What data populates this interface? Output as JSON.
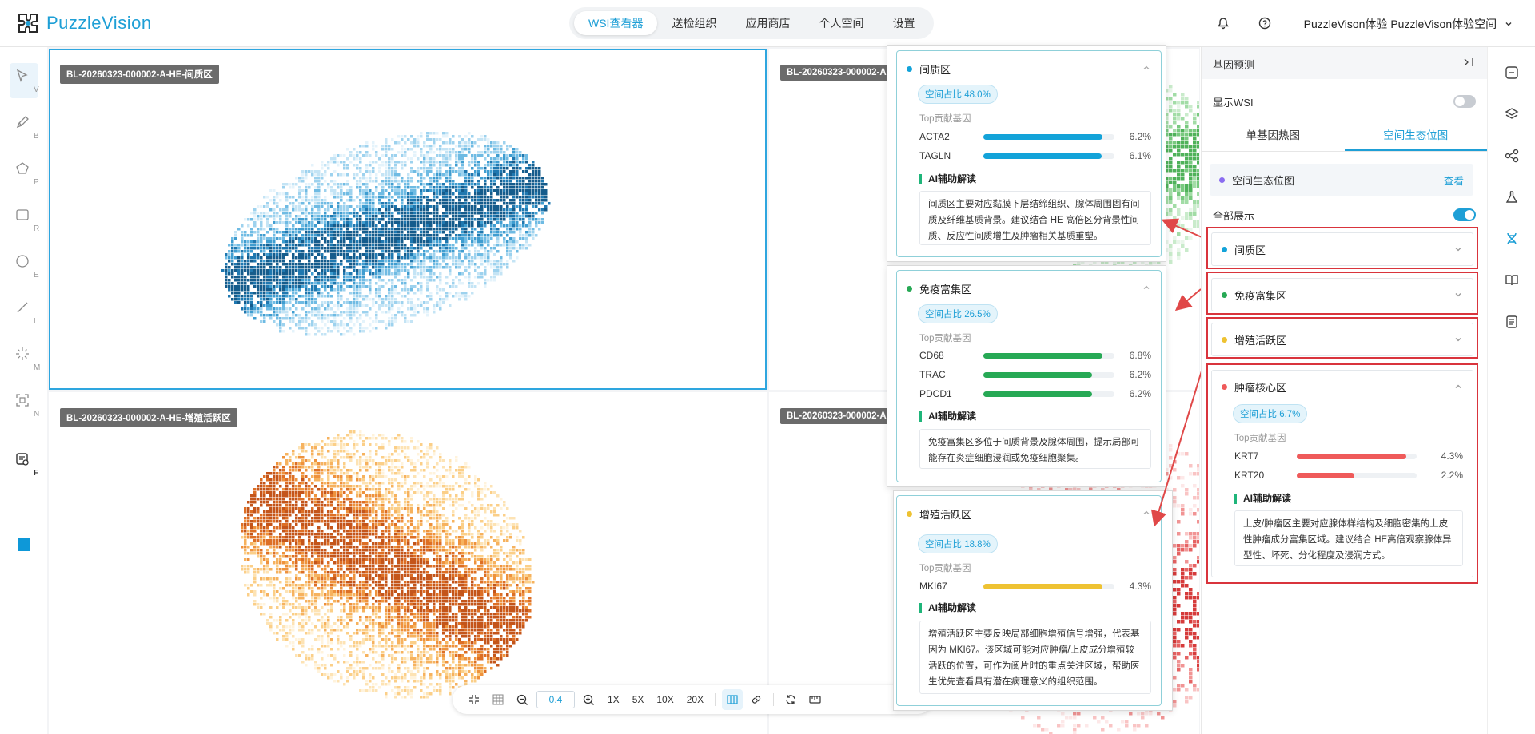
{
  "app": {
    "name": "PuzzleVision"
  },
  "nav": {
    "tabs": [
      "WSI查看器",
      "送检组织",
      "应用商店",
      "个人空间",
      "设置"
    ],
    "active": 0
  },
  "user": {
    "label": "PuzzleVison体验 PuzzleVison体验空间"
  },
  "tools": [
    {
      "name": "select",
      "key": "V"
    },
    {
      "name": "brush",
      "key": "B"
    },
    {
      "name": "polygon",
      "key": "P"
    },
    {
      "name": "rectangle",
      "key": "R"
    },
    {
      "name": "ellipse",
      "key": "E"
    },
    {
      "name": "line",
      "key": "L"
    },
    {
      "name": "magic",
      "key": "M"
    },
    {
      "name": "focus",
      "key": "N"
    },
    {
      "name": "annotation",
      "key": "F"
    }
  ],
  "annotation_color": "#0e98d8",
  "panes": [
    {
      "label": "BL-20260323-000002-A-HE-间质区"
    },
    {
      "label": "BL-20260323-000002-A"
    },
    {
      "label": "BL-20260323-000002-A-HE-增殖活跃区"
    },
    {
      "label": "BL-20260323-000002-A"
    }
  ],
  "bottom_bar": {
    "zoom": "0.4",
    "mags": [
      "1X",
      "5X",
      "10X",
      "20X"
    ]
  },
  "popups": [
    {
      "title": "间质区",
      "color": "#13a3d9",
      "pct": "空间占比 48.0%",
      "genes_header": "Top贡献基因",
      "genes": [
        {
          "name": "ACTA2",
          "value": "6.2%",
          "fill": 0.91
        },
        {
          "name": "TAGLN",
          "value": "6.1%",
          "fill": 0.9
        }
      ],
      "ai_title": "AI辅助解读",
      "ai_text": "间质区主要对应黏膜下层结缔组织、腺体周围固有间质及纤维基质背景。建议结合 HE 高倍区分背景性间质、反应性间质增生及肿瘤相关基质重塑。"
    },
    {
      "title": "免疫富集区",
      "color": "#27a955",
      "pct": "空间占比 26.5%",
      "genes_header": "Top贡献基因",
      "genes": [
        {
          "name": "CD68",
          "value": "6.8%",
          "fill": 0.91
        },
        {
          "name": "TRAC",
          "value": "6.2%",
          "fill": 0.83
        },
        {
          "name": "PDCD1",
          "value": "6.2%",
          "fill": 0.83
        }
      ],
      "ai_title": "AI辅助解读",
      "ai_text": "免疫富集区多位于间质背景及腺体周围，提示局部可能存在炎症细胞浸润或免疫细胞聚集。"
    },
    {
      "title": "增殖活跃区",
      "color": "#eec232",
      "pct": "空间占比 18.8%",
      "genes_header": "Top贡献基因",
      "genes": [
        {
          "name": "MKI67",
          "value": "4.3%",
          "fill": 0.91
        }
      ],
      "ai_title": "AI辅助解读",
      "ai_text": "增殖活跃区主要反映局部细胞增殖信号增强，代表基因为 MKI67。该区域可能对应肿瘤/上皮成分增殖较活跃的位置，可作为阅片时的重点关注区域，帮助医生优先查看具有潜在病理意义的组织范围。"
    }
  ],
  "right_panel": {
    "title": "基因预测",
    "show_wsi": "显示WSI",
    "tabs": [
      "单基因热图",
      "空间生态位图"
    ],
    "section": {
      "label": "空间生态位图",
      "link": "查看"
    },
    "show_all": "全部展示",
    "regions": [
      {
        "title": "间质区",
        "color": "#13a3d9"
      },
      {
        "title": "免疫富集区",
        "color": "#27a955"
      },
      {
        "title": "增殖活跃区",
        "color": "#eec232"
      }
    ],
    "expanded": {
      "title": "肿瘤核心区",
      "color": "#ef5a5a",
      "pct": "空间占比 6.7%",
      "genes_header": "Top贡献基因",
      "genes": [
        {
          "name": "KRT7",
          "value": "4.3%",
          "fill": 0.91
        },
        {
          "name": "KRT20",
          "value": "2.2%",
          "fill": 0.48
        }
      ],
      "ai_title": "AI辅助解读",
      "ai_text": "上皮/肿瘤区主要对应腺体样结构及细胞密集的上皮性肿瘤成分富集区域。建议结合 HE高倍观察腺体异型性、坏死、分化程度及浸润方式。"
    }
  }
}
